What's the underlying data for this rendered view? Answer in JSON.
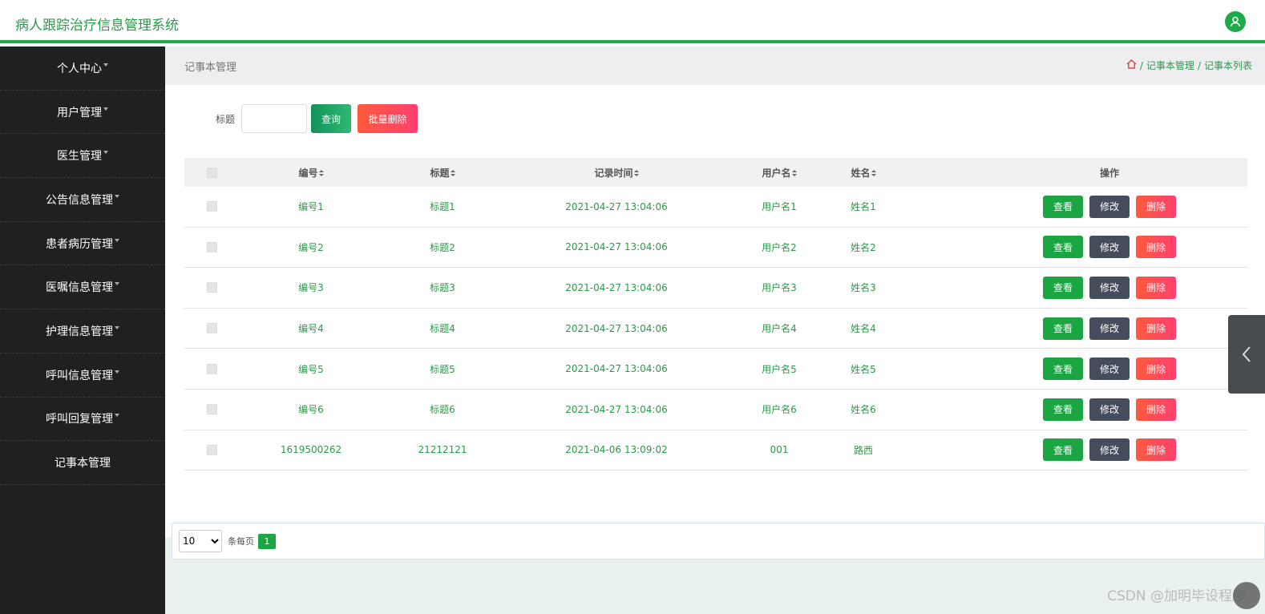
{
  "header": {
    "title": "病人跟踪治疗信息管理系统",
    "user_icon": "user-icon"
  },
  "sidebar": {
    "items": [
      {
        "label": "个人中心"
      },
      {
        "label": "用户管理"
      },
      {
        "label": "医生管理"
      },
      {
        "label": "公告信息管理"
      },
      {
        "label": "患者病历管理"
      },
      {
        "label": "医嘱信息管理"
      },
      {
        "label": "护理信息管理"
      },
      {
        "label": "呼叫信息管理"
      },
      {
        "label": "呼叫回复管理"
      },
      {
        "label": "记事本管理"
      }
    ]
  },
  "breadcrumb": {
    "page_title": "记事本管理",
    "home_icon": "home-icon",
    "sep": "/",
    "level1": "记事本管理",
    "level2": "记事本列表"
  },
  "search": {
    "label": "标题",
    "value": "",
    "placeholder": "",
    "query_button": "查询",
    "batch_delete_button": "批量删除"
  },
  "table": {
    "headers": {
      "id": "编号",
      "title": "标题",
      "time": "记录时间",
      "username": "用户名",
      "name": "姓名",
      "actions": "操作"
    },
    "rows": [
      {
        "id": "编号1",
        "title": "标题1",
        "time": "2021-04-27 13:04:06",
        "username": "用户名1",
        "name": "姓名1"
      },
      {
        "id": "编号2",
        "title": "标题2",
        "time": "2021-04-27 13:04:06",
        "username": "用户名2",
        "name": "姓名2"
      },
      {
        "id": "编号3",
        "title": "标题3",
        "time": "2021-04-27 13:04:06",
        "username": "用户名3",
        "name": "姓名3"
      },
      {
        "id": "编号4",
        "title": "标题4",
        "time": "2021-04-27 13:04:06",
        "username": "用户名4",
        "name": "姓名4"
      },
      {
        "id": "编号5",
        "title": "标题5",
        "time": "2021-04-27 13:04:06",
        "username": "用户名5",
        "name": "姓名5"
      },
      {
        "id": "编号6",
        "title": "标题6",
        "time": "2021-04-27 13:04:06",
        "username": "用户名6",
        "name": "姓名6"
      },
      {
        "id": "1619500262",
        "title": "21212121",
        "time": "2021-04-06 13:09:02",
        "username": "001",
        "name": "路西"
      }
    ],
    "action_labels": {
      "view": "查看",
      "edit": "修改",
      "delete": "删除"
    }
  },
  "pagination": {
    "page_size": "10",
    "per_page_label": "条每页",
    "current_page": "1"
  },
  "watermark": "CSDN @加明毕设程序",
  "colors": {
    "primary_green": "#1ca643",
    "sidebar_bg": "#1f2022",
    "delete_red": "#ff4a4a",
    "edit_gray": "#454c5c"
  }
}
